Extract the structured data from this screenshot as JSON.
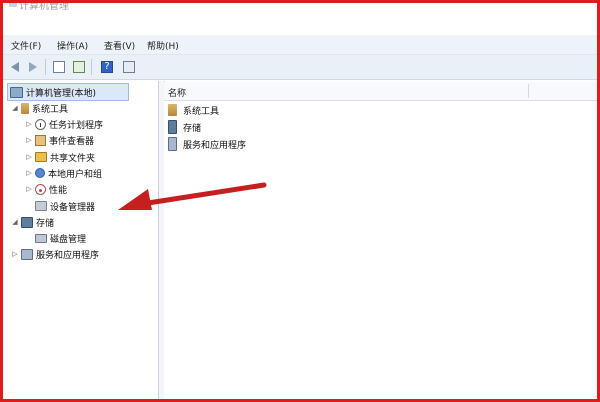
{
  "window": {
    "title": "计算机管理"
  },
  "menu": [
    "文件(F)",
    "操作(A)",
    "查看(V)",
    "帮助(H)"
  ],
  "toolbar": {
    "icons": [
      "back-icon",
      "forward-icon",
      "console-tree-icon",
      "export-icon",
      "help-icon",
      "properties-icon"
    ]
  },
  "tree": {
    "root": "计算机管理(本地)",
    "items": [
      {
        "label": "系统工具",
        "level": 1,
        "expanded": true
      },
      {
        "label": "任务计划程序",
        "level": 2,
        "expanded": false
      },
      {
        "label": "事件查看器",
        "level": 2,
        "expanded": false
      },
      {
        "label": "共享文件夹",
        "level": 2,
        "expanded": false
      },
      {
        "label": "本地用户和组",
        "level": 2,
        "expanded": false
      },
      {
        "label": "性能",
        "level": 2,
        "expanded": false
      },
      {
        "label": "设备管理器",
        "level": 2,
        "expanded": false
      },
      {
        "label": "存储",
        "level": 1,
        "expanded": true
      },
      {
        "label": "磁盘管理",
        "level": 2,
        "expanded": false
      },
      {
        "label": "服务和应用程序",
        "level": 1,
        "expanded": false
      }
    ]
  },
  "content": {
    "column_header": "名称",
    "items": [
      "系统工具",
      "存储",
      "服务和应用程序"
    ]
  },
  "colors": {
    "frame_border": "#e11a1a",
    "annotation_arrow": "#c61f1f",
    "selection": "#dbe8f8"
  }
}
